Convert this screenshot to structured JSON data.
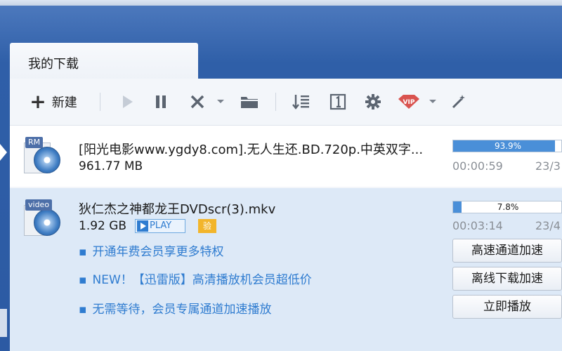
{
  "tab": {
    "label": "我的下载"
  },
  "toolbar": {
    "new_label": "新建",
    "icons": [
      "plus-icon",
      "play-icon",
      "pause-icon",
      "delete-icon",
      "folder-icon",
      "sort-icon",
      "one-icon",
      "gear-icon",
      "vip-icon",
      "magic-wand-icon"
    ]
  },
  "downloads": [
    {
      "icon_tag": "RM",
      "name": "[阳光电影www.ygdy8.com].无人生还.BD.720p.中英双字...",
      "size": "961.77 MB",
      "progress": 93.9,
      "progress_label": "93.9%",
      "remaining": "00:00:59",
      "peers": "23/3"
    },
    {
      "icon_tag": "video",
      "name": "狄仁杰之神都龙王DVDscr(3).mkv",
      "size": "1.92 GB",
      "play_badge": "PLAY",
      "gold_badge": "验",
      "progress": 7.8,
      "progress_label": "7.8%",
      "remaining": "00:03:14",
      "peers": "23/4",
      "promos": [
        "开通年费会员享更多特权",
        "NEW！【迅雷版】高清播放机会员超低价",
        "无需等待，会员专属通道加速播放"
      ],
      "actions": [
        "高速通道加速",
        "离线下载加速",
        "立即播放"
      ]
    }
  ],
  "colors": {
    "accent": "#4a8fd8",
    "link": "#2f7cd0",
    "selected_row": "#dde9f7"
  }
}
